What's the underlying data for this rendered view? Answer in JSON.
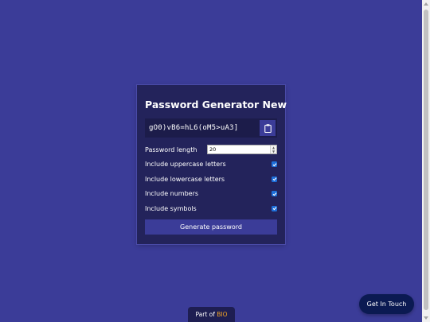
{
  "generator": {
    "title": "Password Generator New",
    "password": "gO0)vB6=hL6(oM5>uA3]",
    "clipboard_icon": "clipboard-icon",
    "settings": {
      "length_label": "Password length",
      "length_value": "20",
      "uppercase_label": "Include uppercase letters",
      "uppercase_checked": true,
      "lowercase_label": "Include lowercase letters",
      "lowercase_checked": true,
      "numbers_label": "Include numbers",
      "numbers_checked": true,
      "symbols_label": "Include symbols",
      "symbols_checked": true
    },
    "generate_label": "Generate password"
  },
  "footer": {
    "part_of_prefix": "Part of ",
    "part_of_brand": "BIO"
  },
  "contact": {
    "label": "Get In Touch"
  },
  "colors": {
    "background": "#3b3c98",
    "card": "#23235b",
    "accent": "#f5a623",
    "checkbox": "#1e6fd9"
  }
}
